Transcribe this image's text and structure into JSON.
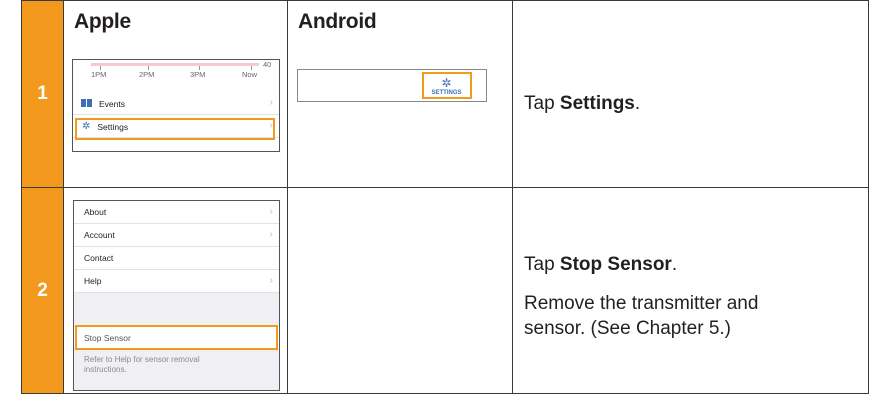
{
  "headers": {
    "apple": "Apple",
    "android": "Android"
  },
  "steps": [
    {
      "number": "1",
      "apple_screen": {
        "axis_value": "40",
        "times": [
          "1PM",
          "2PM",
          "3PM",
          "Now"
        ],
        "menu": [
          {
            "label": "Events"
          },
          {
            "label": "Settings"
          }
        ]
      },
      "android_screen": {
        "button_label": "SETTINGS"
      },
      "instruction": {
        "prefix": "Tap ",
        "bold": "Settings",
        "suffix": "."
      }
    },
    {
      "number": "2",
      "apple_screen": {
        "menu": [
          {
            "label": "About"
          },
          {
            "label": "Account"
          },
          {
            "label": "Contact"
          },
          {
            "label": "Help"
          }
        ],
        "stop_label": "Stop Sensor",
        "note": "Refer to Help for sensor removal instructions."
      },
      "instruction": {
        "prefix": "Tap ",
        "bold": "Stop Sensor",
        "suffix": "."
      },
      "instruction2": "Remove the transmitter and sensor. (See Chapter 5.)"
    }
  ],
  "colors": {
    "accent": "#f39a1e",
    "text": "#231f20",
    "border": "#3a3a3a",
    "icon_blue": "#3d6fb6"
  },
  "icons": [
    "events-icon",
    "gear-icon",
    "chevron-right-icon"
  ]
}
